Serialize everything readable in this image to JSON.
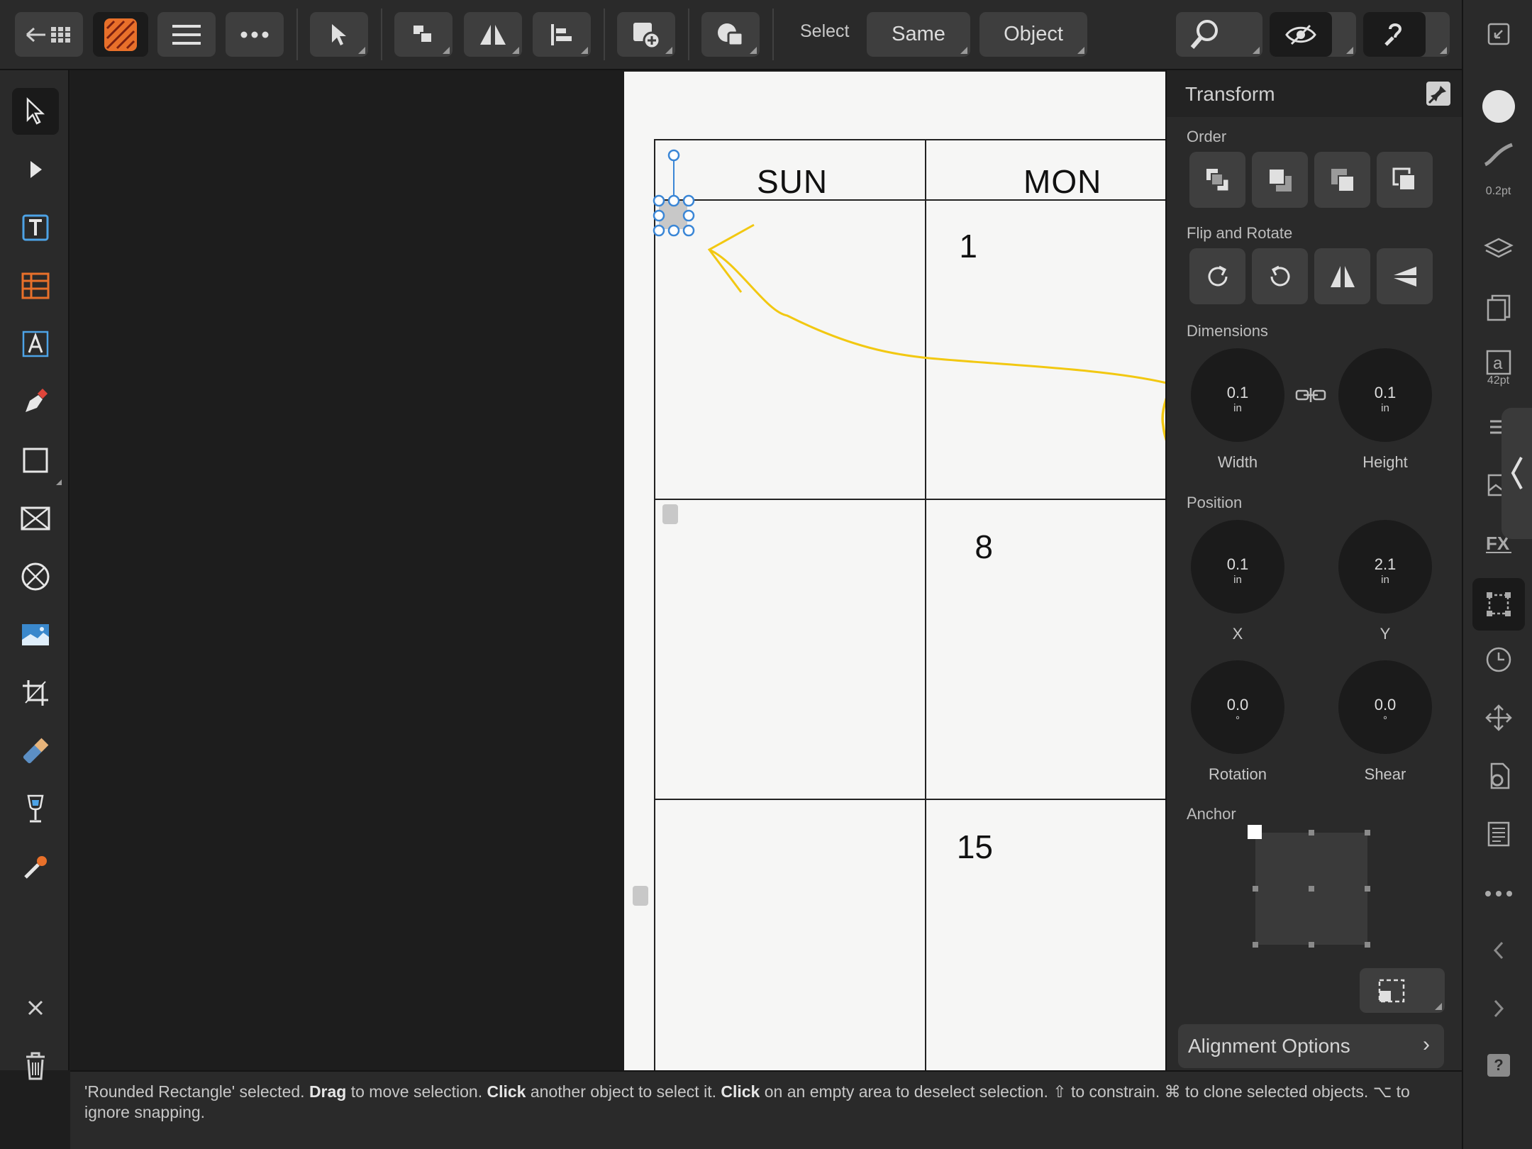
{
  "toolbar": {
    "select_label": "Select",
    "same_button": "Same",
    "object_button": "Object"
  },
  "calendar": {
    "days": [
      "SUN",
      "MON"
    ],
    "dates_sun": [
      "1",
      "8",
      "15"
    ]
  },
  "panel": {
    "title": "Transform",
    "order_label": "Order",
    "flip_rotate_label": "Flip and Rotate",
    "dimensions_label": "Dimensions",
    "width": {
      "value": "0.1",
      "unit": "in",
      "label": "Width"
    },
    "height": {
      "value": "0.1",
      "unit": "in",
      "label": "Height"
    },
    "position_label": "Position",
    "x": {
      "value": "0.1",
      "unit": "in",
      "label": "X"
    },
    "y": {
      "value": "2.1",
      "unit": "in",
      "label": "Y"
    },
    "rotation": {
      "value": "0.0",
      "unit": "°",
      "label": "Rotation"
    },
    "shear": {
      "value": "0.0",
      "unit": "°",
      "label": "Shear"
    },
    "anchor_label": "Anchor",
    "alignment_options": "Alignment Options"
  },
  "right_strip": {
    "stroke_width": "0.2pt",
    "font_size": "42pt"
  },
  "status": {
    "p1": "'Rounded Rectangle' selected.",
    "b1": "Drag",
    "p2": "to move selection.",
    "b2": "Click",
    "p3": "another object to select it.",
    "b3": "Click",
    "p4": "on an empty area to deselect selection. ⇧ to constrain. ⌘ to clone selected objects. ⌥ to ignore snapping."
  },
  "colors": {
    "accent_orange": "#e8702a",
    "annotation_yellow": "#f2c811",
    "selection_blue": "#3a86d6"
  }
}
